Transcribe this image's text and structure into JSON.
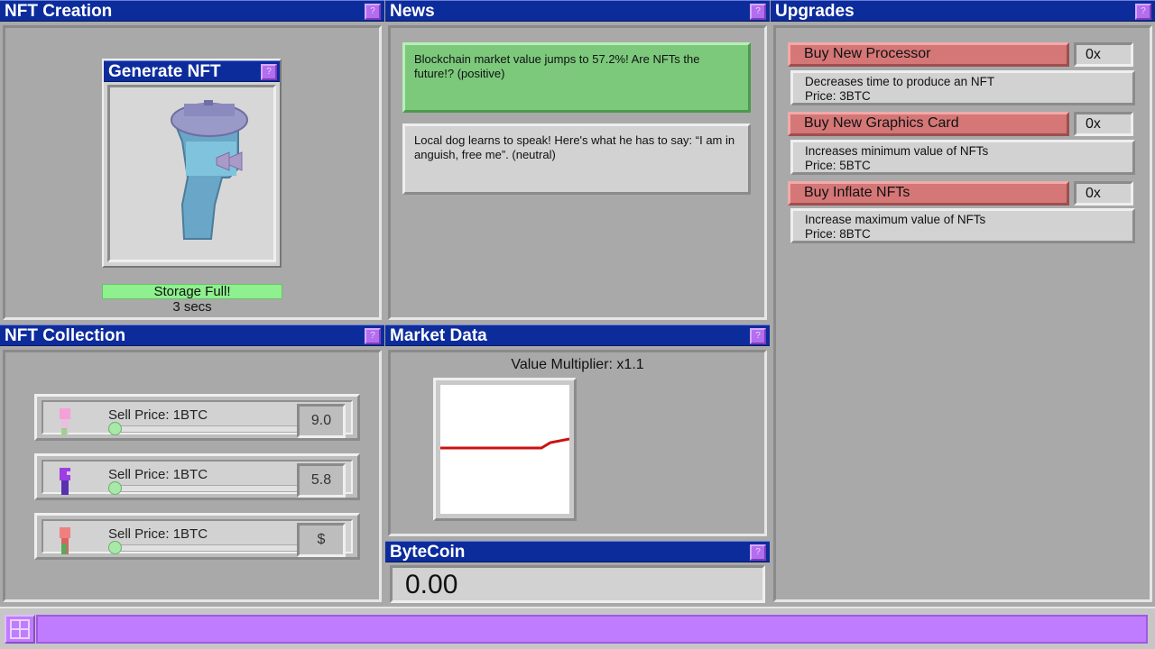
{
  "panels": {
    "creation": {
      "title": "NFT Creation",
      "help": "?"
    },
    "news": {
      "title": "News",
      "help": "?"
    },
    "upgrades": {
      "title": "Upgrades",
      "help": "?"
    },
    "collection": {
      "title": "NFT Collection",
      "help": "?"
    },
    "market": {
      "title": "Market Data",
      "help": "?"
    },
    "bytecoin": {
      "title": "ByteCoin",
      "help": "?"
    }
  },
  "generator": {
    "title": "Generate NFT",
    "help": "?",
    "storage_status": "Storage Full!",
    "timer": "3 secs"
  },
  "news": {
    "items": [
      {
        "text": "Blockchain market value jumps to 57.2%! Are NFTs the future!? (positive)",
        "sentiment": "positive"
      },
      {
        "text": "Local dog learns to speak! Here's what he has to say: “I am in anguish, free me”. (neutral)",
        "sentiment": "neutral"
      }
    ]
  },
  "upgrades": {
    "items": [
      {
        "label": "Buy New Processor",
        "count": "0x",
        "description": "Decreases time to produce an NFT",
        "price": "Price: 3BTC"
      },
      {
        "label": "Buy New Graphics Card",
        "count": "0x",
        "description": "Increases minimum value of NFTs",
        "price": "Price: 5BTC"
      },
      {
        "label": "Buy Inflate NFTs",
        "count": "0x",
        "description": "Increase maximum value of NFTs",
        "price": "Price: 8BTC"
      }
    ]
  },
  "collection": {
    "items": [
      {
        "label": "Sell Price: 1BTC",
        "value": "9.0",
        "color": "#f5a0d8",
        "accent": "#9ad48a",
        "slider": 0.0
      },
      {
        "label": "Sell Price: 1BTC",
        "value": "5.8",
        "color": "#9b3fe0",
        "accent": "#5a2fb0",
        "slider": 0.0
      },
      {
        "label": "Sell Price: 1BTC",
        "value": "$",
        "color": "#f08080",
        "accent": "#5aa85a",
        "slider": 0.0
      }
    ]
  },
  "market": {
    "multiplier_label": "Value Multiplier: x1.1"
  },
  "bytecoin": {
    "balance": "0.00"
  },
  "colors": {
    "title_bar": "#0d2c9c",
    "help_button": "#b36ef0",
    "news_positive": "#7cc97c",
    "upgrade_button": "#d57777",
    "storage_bar": "#8ef08e",
    "chart_line": "#cc1111",
    "taskbar_strip": "#c07cff"
  }
}
